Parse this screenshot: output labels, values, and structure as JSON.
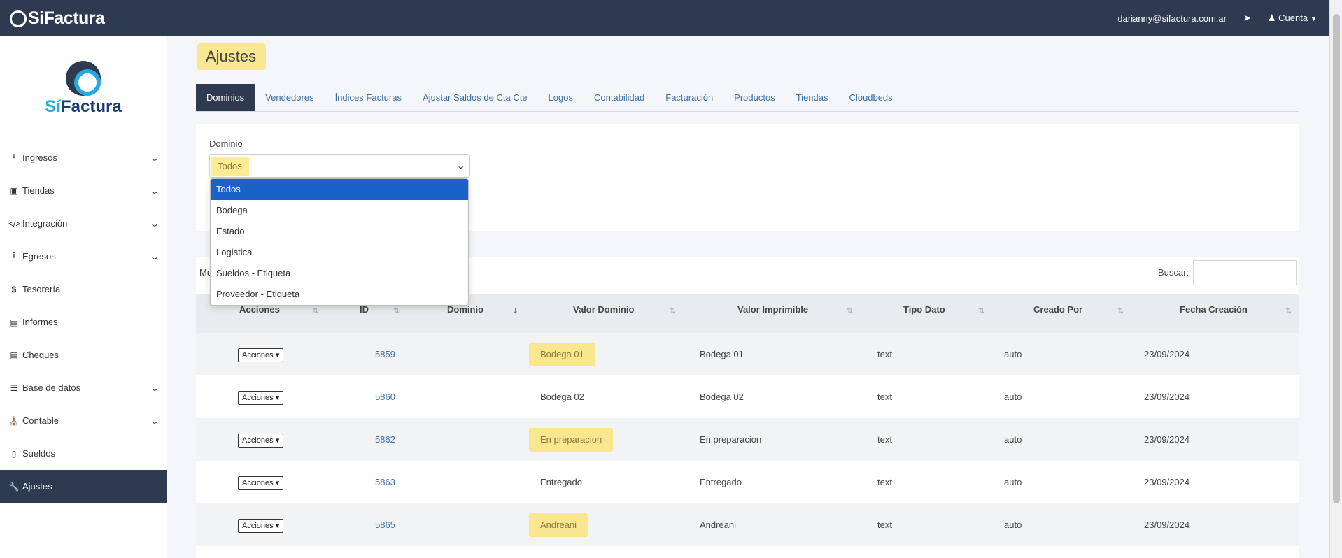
{
  "header": {
    "brand": "SiFactura",
    "user_email": "darianny@sifactura.com.ar",
    "account_label": "Cuenta"
  },
  "sidebar": {
    "logo_si": "Sí",
    "logo_rest": "Factura",
    "items": [
      {
        "label": "Ingresos",
        "icon": "download-icon",
        "expandable": true
      },
      {
        "label": "Tiendas",
        "icon": "shopping-bag-icon",
        "expandable": true
      },
      {
        "label": "Integración",
        "icon": "code-icon",
        "expandable": true
      },
      {
        "label": "Egresos",
        "icon": "upload-icon",
        "expandable": true
      },
      {
        "label": "Tesorería",
        "icon": "dollar-icon",
        "expandable": false
      },
      {
        "label": "Informes",
        "icon": "chart-icon",
        "expandable": false
      },
      {
        "label": "Cheques",
        "icon": "credit-card-icon",
        "expandable": false
      },
      {
        "label": "Base de datos",
        "icon": "database-icon",
        "expandable": true
      },
      {
        "label": "Contable",
        "icon": "bank-icon",
        "expandable": true
      },
      {
        "label": "Sueldos",
        "icon": "book-icon",
        "expandable": false
      },
      {
        "label": "Ajustes",
        "icon": "wrench-icon",
        "expandable": false,
        "active": true
      }
    ]
  },
  "page": {
    "title": "Ajustes"
  },
  "tabs": [
    {
      "label": "Dominios",
      "active": true
    },
    {
      "label": "Vendedores"
    },
    {
      "label": "Índices Facturas"
    },
    {
      "label": "Ajustar Saldos de Cta Cte"
    },
    {
      "label": "Logos"
    },
    {
      "label": "Contabilidad"
    },
    {
      "label": "Facturación"
    },
    {
      "label": "Productos"
    },
    {
      "label": "Tiendas"
    },
    {
      "label": "Cloudbeds"
    }
  ],
  "filter": {
    "label": "Dominio",
    "selected": "Todos",
    "options": [
      "Todos",
      "Bodega",
      "Estado",
      "Logistica",
      "Sueldos - Etiqueta",
      "Proveedor - Etiqueta"
    ]
  },
  "table": {
    "show_label_fragment": "Mo",
    "search_label": "Buscar:",
    "search_value": "",
    "columns": [
      "Acciones",
      "ID",
      "Dominio",
      "Valor Dominio",
      "Valor Imprimible",
      "Tipo Dato",
      "Creado Por",
      "Fecha Creación"
    ],
    "action_label": "Acciones",
    "rows": [
      {
        "id": "5859",
        "dominio": "",
        "valor_dominio": "Bodega 01",
        "valor_imprimible": "Bodega 01",
        "tipo": "text",
        "creado_por": "auto",
        "fecha": "23/09/2024"
      },
      {
        "id": "5860",
        "dominio": "",
        "valor_dominio": "Bodega 02",
        "valor_imprimible": "Bodega 02",
        "tipo": "text",
        "creado_por": "auto",
        "fecha": "23/09/2024"
      },
      {
        "id": "5862",
        "dominio": "",
        "valor_dominio": "En preparacion",
        "valor_imprimible": "En preparacion",
        "tipo": "text",
        "creado_por": "auto",
        "fecha": "23/09/2024"
      },
      {
        "id": "5863",
        "dominio": "",
        "valor_dominio": "Entregado",
        "valor_imprimible": "Entregado",
        "tipo": "text",
        "creado_por": "auto",
        "fecha": "23/09/2024"
      },
      {
        "id": "5865",
        "dominio": "",
        "valor_dominio": "Andreani",
        "valor_imprimible": "Andreani",
        "tipo": "text",
        "creado_por": "auto",
        "fecha": "23/09/2024"
      }
    ]
  }
}
